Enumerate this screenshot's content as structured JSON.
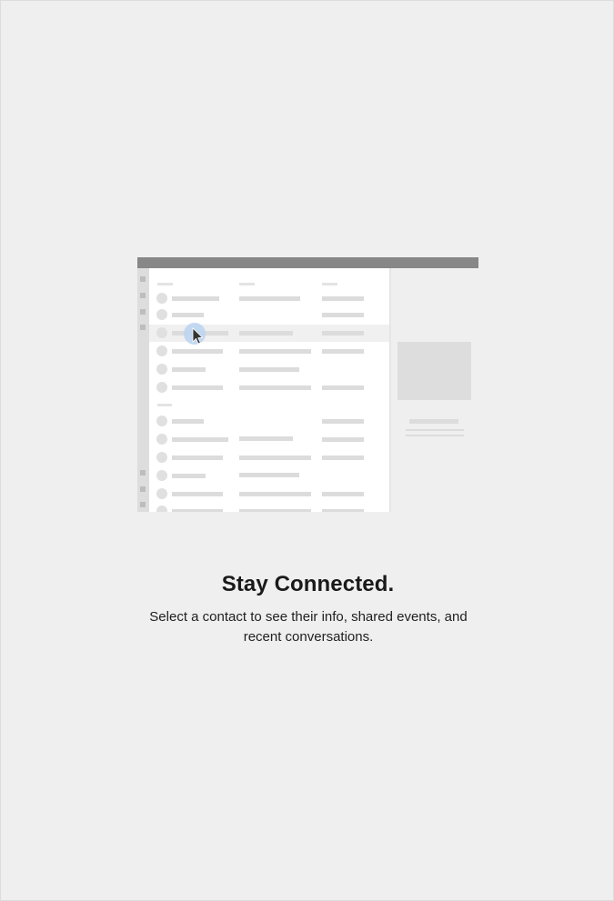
{
  "empty_state": {
    "title": "Stay Connected.",
    "description": "Select a contact to see their info, shared events, and recent conversations.",
    "illustration_icon": "contacts-list-illustration"
  },
  "colors": {
    "background": "#efefef",
    "titlebar": "#878787",
    "placeholder": "#d9d9d9",
    "highlight": "#bcd4f0"
  }
}
